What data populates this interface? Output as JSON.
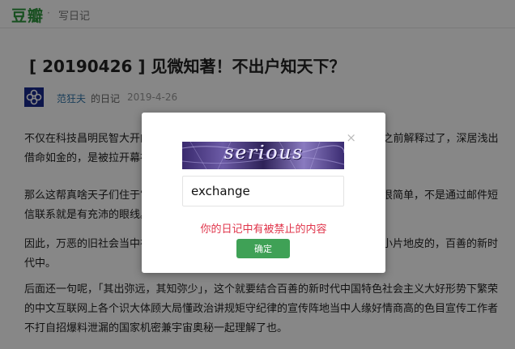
{
  "header": {
    "logo": "豆瓣",
    "separator": "·",
    "nav_label": "写日记"
  },
  "article": {
    "title": "[ 20190426 ] 见微知著！不出户知天下？",
    "author": "范狂夫",
    "diary_label": "的日记",
    "date": "2019-4-26",
    "paragraphs": [
      "不仅在科技昌明民智大开的现代社会，古人所谓“不出户知天下”有实现可能。之前解释过了，深居浅出借命如金的，是被拉开幕布直面人间百态的舞台上的跑腿的奴才。",
      "那么这帮真啥天子们住于宫殿，怎么做到见微知著不出户知天下的神学法呢？很简单，不是通过邮件短信联系就是有充沛的眼线。",
      "因此，万恶的旧社会当中在被蒙在鼓里的中间人要和一流和谐宜居之都周围一小片地皮的，百善的新时代中。",
      "后面还一句呢，「其出弥远，其知弥少」，这个就要结合百善的新时代中国特色社会主义大好形势下繁荣的中文互联网上各个识大体顾大局懂政治讲规矩守纪律的宣传阵地当中人缘好情商高的色目宣传工作者不打自招爆料泄漏的国家机密兼宇宙奥秘一起理解了也。"
    ]
  },
  "dialog": {
    "close_icon": "×",
    "captcha_text": "serious",
    "captcha_input_value": "exchange",
    "error_message": "你的日记中有被禁止的内容",
    "confirm_label": "确定"
  },
  "colors": {
    "brand": "#2e963d",
    "error": "#e0354b",
    "confirm": "#3fa156",
    "link": "#3377aa"
  }
}
